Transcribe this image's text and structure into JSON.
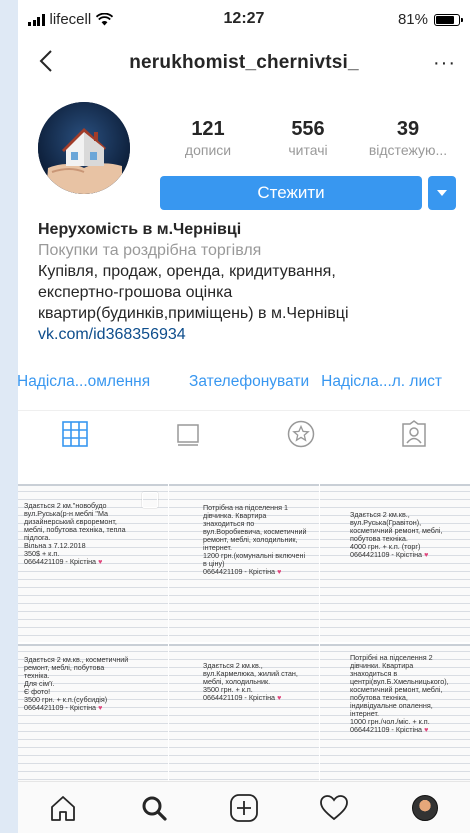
{
  "status": {
    "carrier": "lifecell",
    "time": "12:27",
    "battery": "81%",
    "battery_level": 0.81
  },
  "header": {
    "username": "nerukhomist_chernivtsi_",
    "more": "···"
  },
  "stats": [
    {
      "value": "121",
      "label": "дописи"
    },
    {
      "value": "556",
      "label": "читачі"
    },
    {
      "value": "39",
      "label": "відстежую..."
    }
  ],
  "follow": {
    "label": "Стежити"
  },
  "bio": {
    "name": "Нерухомість в м.Чернівці",
    "category": "Покупки та роздрібна торгівля",
    "line1": "Купівля, продаж, оренда, кридитування,",
    "line2": "експертно-грошова оцінка",
    "line3": "квартир(будинків,приміщень) в м.Чернівці",
    "link": "vk.com/id368356934"
  },
  "actions": {
    "message": "Надісла...омлення",
    "call": "Зателефонувати",
    "email": "Надісла...л. лист"
  },
  "tabs": {
    "icons": [
      "grid-icon",
      "feed-icon",
      "star-icon",
      "tagged-icon"
    ]
  },
  "posts": [
    {
      "lines": [
        "Здається 2 км.\"новобудо",
        "вул.Руська(р-н меблі \"Ма",
        "дизайнерський євроремонт,",
        "меблі, побутова техніка, тепла",
        "підлога.",
        "Вільна з 7.12.2018",
        "350$ + к.п.",
        "0664421109 - Крістіна"
      ]
    },
    {
      "lines": [
        "Потрібна на підселення 1",
        "дівчинка. Квартира",
        "знаходиться по",
        "вул.Воробкевича, косметичний",
        "ремонт, меблі, холодильник,",
        "інтернет.",
        "1200 грн.(комунальні включені",
        "в ціну)",
        "0664421109 - Крістіна"
      ]
    },
    {
      "lines": [
        "Здається 2 км.кв.,",
        "вул.Руська(Гравітон),",
        "косметичний ремонт, меблі,",
        "побутова техніка.",
        "4000 грн. + к.п. (торг)",
        "0664421109 - Крістіна"
      ]
    },
    {
      "lines": [
        "Здається 2 км.кв., косметичний",
        "ремонт, меблі, побутова",
        "техніка.",
        "Для сім'ї.",
        "Є фото!",
        "3500 грн. + к.п.(субсидія)",
        "0664421109 - Крістіна"
      ]
    },
    {
      "lines": [
        "Здається 2 км.кв.,",
        "вул.Кармелюка, жилий стан,",
        "меблі, холодильник.",
        "3500 грн. + к.п.",
        "0664421109 - Крістіна"
      ]
    },
    {
      "lines": [
        "Потрібні на підселення 2",
        "дівчинки. Квартира",
        "знаходиться в",
        "центрі(вул.Б.Хмельницького),",
        "косметичний ремонт, меблі,",
        "побутова техніка,",
        "індивідуальне опалення,",
        "інтернет.",
        "1000 грн./чол./міс. + к.п.",
        "0664421109 - Крістіна"
      ]
    }
  ],
  "bottom_tabs": [
    "home-icon",
    "search-icon",
    "add-post-icon",
    "activity-icon",
    "profile-icon"
  ]
}
